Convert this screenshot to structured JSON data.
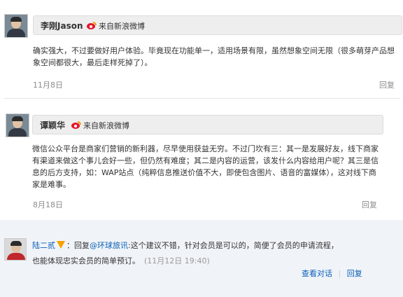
{
  "comments": [
    {
      "user": "李刚Jason",
      "source_label": "来自新浪微博",
      "text": "确实强大，不过要做好用户体验。毕竟现在功能单一，适用场景有限，虽然想象空间无限（很多萌芽产品想象空间都很大，最后走样死掉了）。",
      "date": "11月8日",
      "reply_label": "回复"
    },
    {
      "user": "谭颖华",
      "source_label": "来自新浪微博",
      "text": "微信公众平台是商家们营销的新利器，尽早使用获益无穷。不过门坎有三：其一是发展好友，线下商家有渠道来做这个事儿会好一些，但仍然有难度；其二是内容的运营，该发什么内容给用户呢？其三是信息的后方支持，如：WAP站点（纯粹信息推送价值不大，即使包含图片、语音的富媒体），这对线下商家是难事。",
      "date": "8月18日",
      "reply_label": "回复"
    }
  ],
  "reply_item": {
    "user": "陆二贰",
    "badge_icon": "verified-v-icon",
    "prefix": "：回复",
    "mention": "@环球旅讯",
    "text_part1": ":这个建议不错，针对会员是可以的，简便了会员的申请流程，",
    "text_part2": "也能体现忠实会员的简单预订。",
    "time": "(11月12日 19:40)",
    "view_conversation": "查看对话",
    "divider": "|",
    "reply_label": "回复"
  }
}
